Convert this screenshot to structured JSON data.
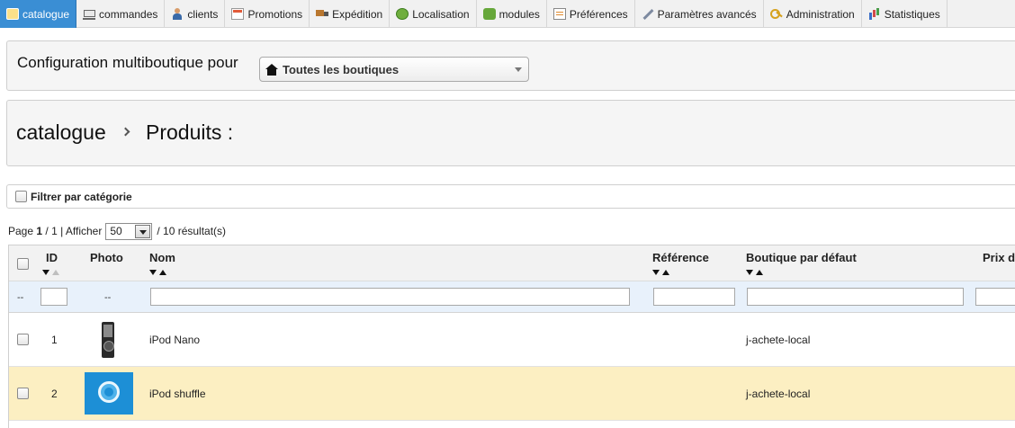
{
  "nav": {
    "tabs": [
      {
        "label": "catalogue",
        "icon": "folder-icon",
        "active": true
      },
      {
        "label": "commandes",
        "icon": "cart-icon"
      },
      {
        "label": "clients",
        "icon": "person-icon"
      },
      {
        "label": "Promotions",
        "icon": "promo-icon"
      },
      {
        "label": "Expédition",
        "icon": "truck-icon"
      },
      {
        "label": "Localisation",
        "icon": "globe-icon"
      },
      {
        "label": "modules",
        "icon": "puzzle-icon"
      },
      {
        "label": "Préférences",
        "icon": "preferences-icon"
      },
      {
        "label": "Paramètres avancés",
        "icon": "wrench-icon"
      },
      {
        "label": "Administration",
        "icon": "key-icon"
      },
      {
        "label": "Statistiques",
        "icon": "stats-icon"
      }
    ],
    "active_color": "#3a8ed4"
  },
  "shop_config": {
    "label": "Configuration multiboutique pour",
    "selected": "Toutes les boutiques"
  },
  "breadcrumb": {
    "section": "catalogue",
    "page": "Produits :"
  },
  "filter": {
    "label": "Filtrer par catégorie"
  },
  "pagination": {
    "page_label": "Page",
    "current": "1",
    "total": "/ 1",
    "show_label": "| Afficher",
    "per_page": "50",
    "results": "/ 10 résultat(s)"
  },
  "table": {
    "columns": {
      "id": "ID",
      "photo": "Photo",
      "name": "Nom",
      "reference": "Référence",
      "default_shop": "Boutique par défaut",
      "price": "Prix d"
    },
    "filter_dash": "--",
    "rows": [
      {
        "id": "1",
        "name": "iPod Nano",
        "reference": "",
        "shop": "j-achete-local",
        "image": "ipod-nano-image"
      },
      {
        "id": "2",
        "name": "iPod shuffle",
        "reference": "",
        "shop": "j-achete-local",
        "image": "ipod-shuffle-image"
      }
    ],
    "highlight_color": "#fcefc2"
  }
}
